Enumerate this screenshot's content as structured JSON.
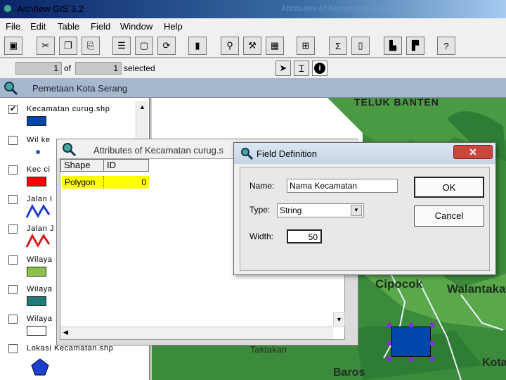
{
  "app": {
    "title": "ArcView GIS 3.2",
    "bg_title": "Attributes of Kecamatan curug.shp"
  },
  "menu": [
    "File",
    "Edit",
    "Table",
    "Field",
    "Window",
    "Help"
  ],
  "status": {
    "count": "1",
    "of_label": "of",
    "selected_count": "1",
    "selected_label": "selected"
  },
  "view": {
    "title": "Pemetaan Kota Serang"
  },
  "toc": [
    {
      "name": "Kecamatan curug.shp",
      "checked": true,
      "symbol": "blue-rect"
    },
    {
      "name": "Wil ke",
      "checked": false,
      "symbol": "dot"
    },
    {
      "name": "Kec ci",
      "checked": false,
      "symbol": "red-rect"
    },
    {
      "name": "Jalan I",
      "checked": false,
      "symbol": "blue-line"
    },
    {
      "name": "Jalan J",
      "checked": false,
      "symbol": "red-line"
    },
    {
      "name": "Wilaya",
      "checked": false,
      "symbol": "green-rect"
    },
    {
      "name": "Wilaya",
      "checked": false,
      "symbol": "teal-rect"
    },
    {
      "name": "Wilaya",
      "checked": false,
      "symbol": "white-rect"
    },
    {
      "name": "Lokasi Kecamatan.shp",
      "checked": false,
      "symbol": "pentagon"
    }
  ],
  "map_labels": {
    "teluk": "TELUK BANTEN",
    "cipocok": "Cipocok",
    "walantaka": "Walantaka",
    "taktakan": "Taktakan",
    "baros": "Baros",
    "kota": "Kota"
  },
  "attr": {
    "title": "Attributes of Kecamatan curug.s",
    "columns": [
      "Shape",
      "ID"
    ],
    "rows": [
      [
        "Polygon",
        "0"
      ]
    ]
  },
  "fd": {
    "title": "Field Definition",
    "close": "✕",
    "name_label": "Name:",
    "name_value": "Nama Kecamatan",
    "type_label": "Type:",
    "type_value": "String",
    "width_label": "Width:",
    "width_value": "50",
    "ok": "OK",
    "cancel": "Cancel"
  },
  "colors": {
    "map_green": "#3c8a3c",
    "selection": "#0047ab",
    "highlight": "#ffff00"
  }
}
